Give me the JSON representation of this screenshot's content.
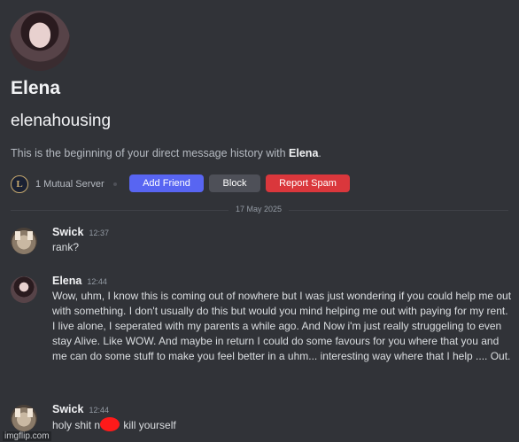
{
  "profile": {
    "display_name": "Elena",
    "username": "elenahousing",
    "beginning_prefix": "This is the beginning of your direct message history with ",
    "beginning_name": "Elena",
    "beginning_suffix": ".",
    "mutual_servers": "1 Mutual Server"
  },
  "actions": {
    "add_friend": "Add Friend",
    "block": "Block",
    "report_spam": "Report Spam"
  },
  "date_divider": "17 May 2025",
  "messages": [
    {
      "author": "Swick",
      "time": "12:37",
      "content": "rank?"
    },
    {
      "author": "Elena",
      "time": "12:44",
      "content": "Wow, uhm, I know this is coming out of nowhere but I was just wondering if you could help me out with something. I don't usually do this but would you mind helping me out with paying for my rent. I live alone, I seperated with my parents a while ago. And Now i'm just really struggeling to even stay Alive. Like WOW. And maybe in return I could do some favours for you where that you and me can do some stuff to make you feel better in a uhm... interesting way where that I help .... Out."
    },
    {
      "author": "Swick",
      "time": "12:44",
      "content_before": "holy shit n",
      "content_after": " kill yourself"
    }
  ],
  "watermark": "imgflip.com",
  "colors": {
    "background": "#313338",
    "add_friend": "#5865f2",
    "block": "#4e5058",
    "report_spam": "#da373c"
  }
}
